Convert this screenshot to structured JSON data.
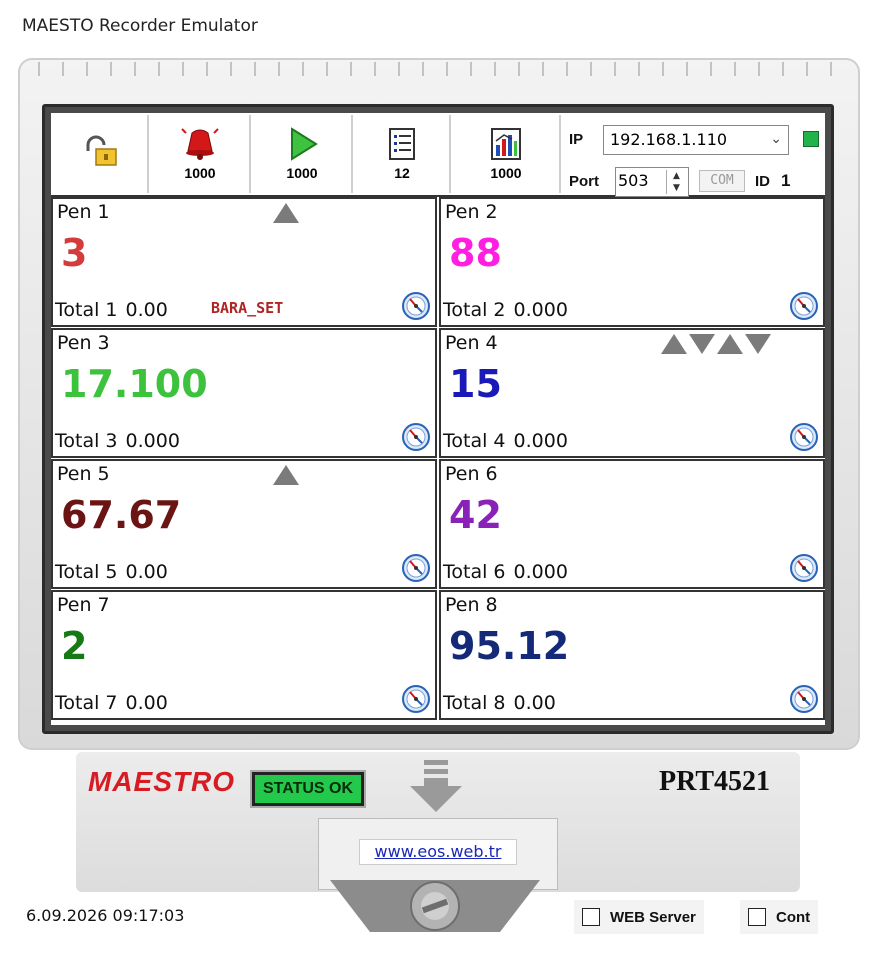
{
  "app_title": "MAESTO Recorder Emulator",
  "toolbar": {
    "buttons": [
      {
        "icon": "unlock-icon",
        "label": ""
      },
      {
        "icon": "alarm-bell-icon",
        "label": "1000"
      },
      {
        "icon": "play-icon",
        "label": "1000"
      },
      {
        "icon": "list-icon",
        "label": "12"
      },
      {
        "icon": "chart-icon",
        "label": "1000"
      }
    ],
    "ip_label": "IP",
    "ip_value": "192.168.1.110",
    "port_label": "Port",
    "port_value": "503",
    "com_label": "COM",
    "id_label": "ID",
    "id_value": "1",
    "connection_status_color": "#22b24a"
  },
  "pens": [
    {
      "name": "Pen 1",
      "value": "3",
      "color": "#d23c3c",
      "total_label": "Total 1",
      "total_value": "0.00",
      "tag": "BARA_SET"
    },
    {
      "name": "Pen 2",
      "value": "88",
      "color": "#ff1fe0",
      "total_label": "Total 2",
      "total_value": "0.000",
      "tag": ""
    },
    {
      "name": "Pen 3",
      "value": "17.100",
      "color": "#3dc23d",
      "total_label": "Total 3",
      "total_value": "0.000",
      "tag": ""
    },
    {
      "name": "Pen 4",
      "value": "15",
      "color": "#1a1ab8",
      "total_label": "Total 4",
      "total_value": "0.000",
      "tag": ""
    },
    {
      "name": "Pen 5",
      "value": "67.67",
      "color": "#6b1414",
      "total_label": "Total 5",
      "total_value": "0.00",
      "tag": ""
    },
    {
      "name": "Pen 6",
      "value": "42",
      "color": "#8a22b8",
      "total_label": "Total 6",
      "total_value": "0.000",
      "tag": ""
    },
    {
      "name": "Pen 7",
      "value": "2",
      "color": "#157a15",
      "total_label": "Total 7",
      "total_value": "0.00",
      "tag": ""
    },
    {
      "name": "Pen 8",
      "value": "95.12",
      "color": "#142a78",
      "total_label": "Total 8",
      "total_value": "0.00",
      "tag": ""
    }
  ],
  "device": {
    "brand": "MAESTRO",
    "status": "STATUS OK",
    "model": "PRT4521",
    "website": "www.eos.web.tr"
  },
  "footer": {
    "timestamp": "6.09.2026 09:17:03",
    "web_server_label": "WEB Server",
    "cont_label": "Cont"
  }
}
